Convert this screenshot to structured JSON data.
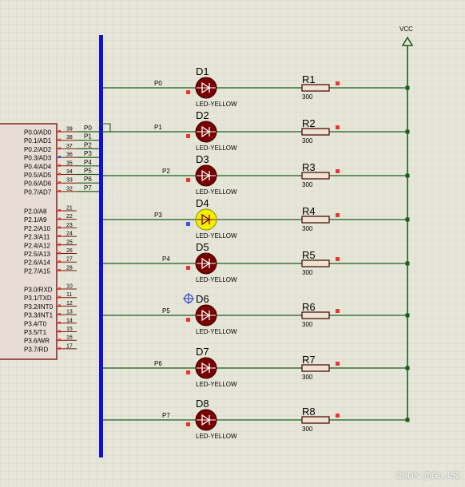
{
  "vcc_label": "VCC",
  "watermark": "CSDN @Gn.452",
  "colors": {
    "background": "#e6e6d8",
    "grid": "#c9c9b6",
    "wire": "#1e5a1e",
    "bus": "#1010d8",
    "led_off": "#7a0000",
    "led_on": "#f0f000",
    "chip_body": "#e8dcd6",
    "chip_border": "#7a1515",
    "resistor_fill": "#efe3cf",
    "pin_marker": "#e33"
  },
  "mcu": {
    "port0": [
      {
        "name": "P0.0/AD0",
        "pin": "39",
        "wire": "P0"
      },
      {
        "name": "P0.1/AD1",
        "pin": "38",
        "wire": "P1"
      },
      {
        "name": "P0.2/AD2",
        "pin": "37",
        "wire": "P2"
      },
      {
        "name": "P0.3/AD3",
        "pin": "36",
        "wire": "P3"
      },
      {
        "name": "P0.4/AD4",
        "pin": "35",
        "wire": "P4"
      },
      {
        "name": "P0.5/AD5",
        "pin": "34",
        "wire": "P5"
      },
      {
        "name": "P0.6/AD6",
        "pin": "33",
        "wire": "P6"
      },
      {
        "name": "P0.7/AD7",
        "pin": "32",
        "wire": "P7"
      }
    ],
    "port2": [
      {
        "name": "P2.0/A8",
        "pin": "21"
      },
      {
        "name": "P2.1/A9",
        "pin": "22"
      },
      {
        "name": "P2.2/A10",
        "pin": "23"
      },
      {
        "name": "P2.3/A11",
        "pin": "24"
      },
      {
        "name": "P2.4/A12",
        "pin": "25"
      },
      {
        "name": "P2.5/A13",
        "pin": "26"
      },
      {
        "name": "P2.6/A14",
        "pin": "27"
      },
      {
        "name": "P2.7/A15",
        "pin": "28"
      }
    ],
    "port3": [
      {
        "name": "P3.0/RXD",
        "pin": "10"
      },
      {
        "name": "P3.1/TXD",
        "pin": "11"
      },
      {
        "name": "P3.2/INT0",
        "pin": "12"
      },
      {
        "name": "P3.3/INT1",
        "pin": "13"
      },
      {
        "name": "P3.4/T0",
        "pin": "14"
      },
      {
        "name": "P3.5/T1",
        "pin": "15"
      },
      {
        "name": "P3.6/WR",
        "pin": "16"
      },
      {
        "name": "P3.7/RD",
        "pin": "17"
      }
    ]
  },
  "channels": [
    {
      "net": "P0",
      "led": "D1",
      "led_type": "LED-YELLOW",
      "resistor": "R1",
      "value": "300",
      "lit": false
    },
    {
      "net": "P1",
      "led": "D2",
      "led_type": "LED-YELLOW",
      "resistor": "R2",
      "value": "300",
      "lit": false
    },
    {
      "net": "P2",
      "led": "D3",
      "led_type": "LED-YELLOW",
      "resistor": "R3",
      "value": "300",
      "lit": false
    },
    {
      "net": "P3",
      "led": "D4",
      "led_type": "LED-YELLOW",
      "resistor": "R4",
      "value": "300",
      "lit": true
    },
    {
      "net": "P4",
      "led": "D5",
      "led_type": "LED-YELLOW",
      "resistor": "R5",
      "value": "300",
      "lit": false
    },
    {
      "net": "P5",
      "led": "D6",
      "led_type": "LED-YELLOW",
      "resistor": "R6",
      "value": "300",
      "lit": false
    },
    {
      "net": "P6",
      "led": "D7",
      "led_type": "LED-YELLOW",
      "resistor": "R7",
      "value": "300",
      "lit": false
    },
    {
      "net": "P7",
      "led": "D8",
      "led_type": "LED-YELLOW",
      "resistor": "R8",
      "value": "300",
      "lit": false
    }
  ]
}
